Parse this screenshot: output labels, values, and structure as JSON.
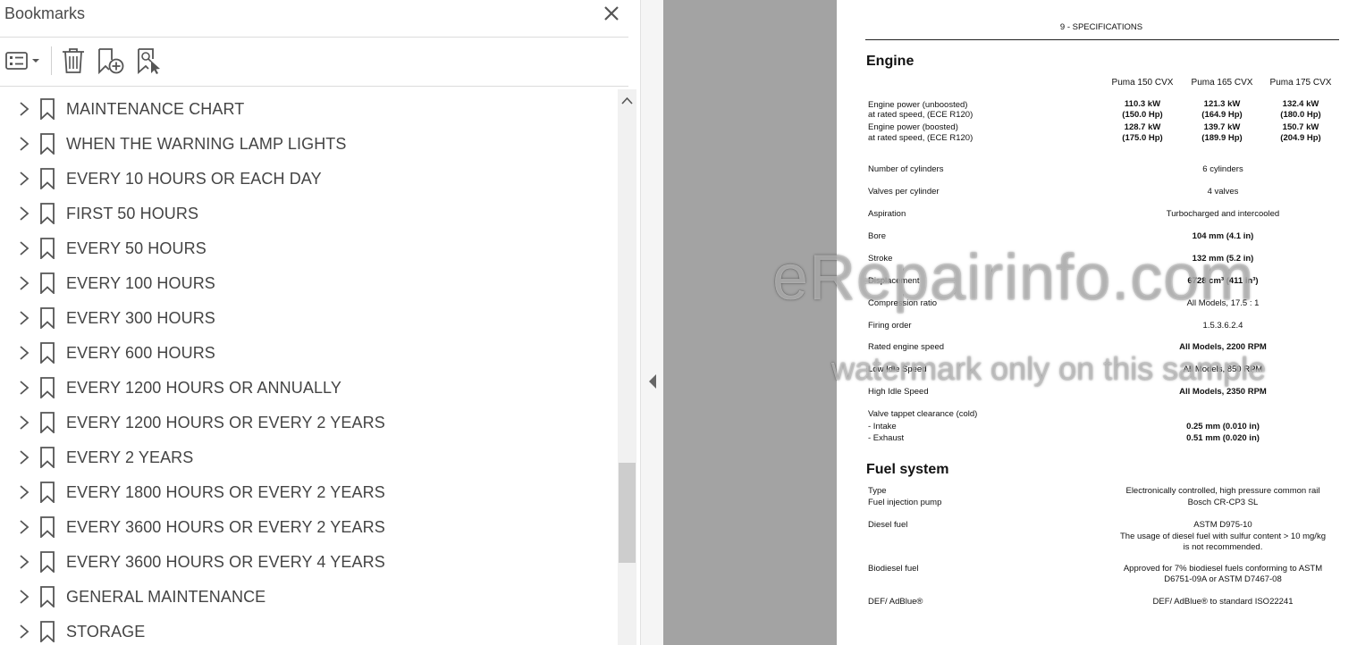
{
  "bookmarks": {
    "title": "Bookmarks",
    "toolbar": {
      "options_icon": "list-options-icon",
      "delete_icon": "trash-icon",
      "new_bookmark_icon": "bookmark-add-icon",
      "find_bookmark_icon": "bookmark-search-icon"
    },
    "items": [
      {
        "label": "MAINTENANCE CHART"
      },
      {
        "label": "WHEN THE WARNING LAMP LIGHTS"
      },
      {
        "label": "EVERY 10 HOURS OR EACH DAY"
      },
      {
        "label": "FIRST 50 HOURS"
      },
      {
        "label": "EVERY 50 HOURS"
      },
      {
        "label": "EVERY 100 HOURS"
      },
      {
        "label": "EVERY 300 HOURS"
      },
      {
        "label": "EVERY 600 HOURS"
      },
      {
        "label": "EVERY 1200 HOURS OR ANNUALLY"
      },
      {
        "label": "EVERY 1200 HOURS OR EVERY 2 YEARS"
      },
      {
        "label": "EVERY 2 YEARS"
      },
      {
        "label": "EVERY 1800 HOURS OR EVERY 2 YEARS"
      },
      {
        "label": "EVERY 3600 HOURS OR EVERY 2 YEARS"
      },
      {
        "label": "EVERY 3600 HOURS OR EVERY 4 YEARS"
      },
      {
        "label": "GENERAL MAINTENANCE"
      },
      {
        "label": "STORAGE"
      }
    ]
  },
  "page": {
    "header": "9 - SPECIFICATIONS",
    "engine": {
      "title": "Engine",
      "columns": [
        "Puma 150 CVX",
        "Puma 165 CVX",
        "Puma 175 CVX"
      ],
      "power_unboosted_label1": "Engine power (unboosted)",
      "power_unboosted_label2": "at rated speed, (ECE R120)",
      "power_unboosted_kw": [
        "110.3 kW",
        "121.3 kW",
        "132.4 kW"
      ],
      "power_unboosted_hp": [
        "(150.0 Hp)",
        "(164.9 Hp)",
        "(180.0 Hp)"
      ],
      "power_boosted_label1": "Engine power (boosted)",
      "power_boosted_label2": "at rated speed, (ECE R120)",
      "power_boosted_kw": [
        "128.7 kW",
        "139.7 kW",
        "150.7 kW"
      ],
      "power_boosted_hp": [
        "(175.0 Hp)",
        "(189.9 Hp)",
        "(204.9 Hp)"
      ],
      "cylinders_label": "Number of cylinders",
      "cylinders_value": "6 cylinders",
      "valves_label": "Valves per cylinder",
      "valves_value": "4 valves",
      "aspiration_label": "Aspiration",
      "aspiration_value": "Turbocharged and intercooled",
      "bore_label": "Bore",
      "bore_value": "104 mm (4.1 in)",
      "stroke_label": "Stroke",
      "stroke_value": "132 mm (5.2 in)",
      "displacement_label": "Displacement",
      "displacement_value": "6728 cm³ (411 in³)",
      "compression_label": "Compression ratio",
      "compression_value": "All Models, 17.5 : 1",
      "firing_label": "Firing order",
      "firing_value": "1.5.3.6.2.4",
      "rated_speed_label": "Rated engine speed",
      "rated_speed_value": "All Models, 2200 RPM",
      "low_idle_label": "Low Idle Speed",
      "low_idle_value": "All Models, 850 RPM",
      "high_idle_label": "High Idle Speed",
      "high_idle_value": "All Models, 2350 RPM",
      "tappet_label": "Valve tappet clearance (cold)",
      "intake_label": "- Intake",
      "intake_value": "0.25 mm (0.010 in)",
      "exhaust_label": "- Exhaust",
      "exhaust_value": "0.51 mm (0.020 in)"
    },
    "fuel": {
      "title": "Fuel system",
      "type_label": "Type",
      "type_value": "Electronically controlled, high pressure common rail",
      "pump_label": "Fuel injection pump",
      "pump_value": "Bosch CR-CP3 SL",
      "diesel_label": "Diesel fuel",
      "diesel_value1": "ASTM D975-10",
      "diesel_value2": "The usage of diesel fuel with sulfur content > 10 mg/kg",
      "diesel_value3": "is not recommended.",
      "biodiesel_label": "Biodiesel fuel",
      "biodiesel_value1": "Approved for 7% biodiesel fuels conforming to ASTM",
      "biodiesel_value2": "D6751-09A or ASTM D7467-08",
      "def_label": "DEF/ AdBlue®",
      "def_value": "DEF/ AdBlue® to standard ISO22241"
    }
  },
  "watermark": {
    "line1": "eRepairinfo.com",
    "line2": "watermark only on this sample"
  }
}
